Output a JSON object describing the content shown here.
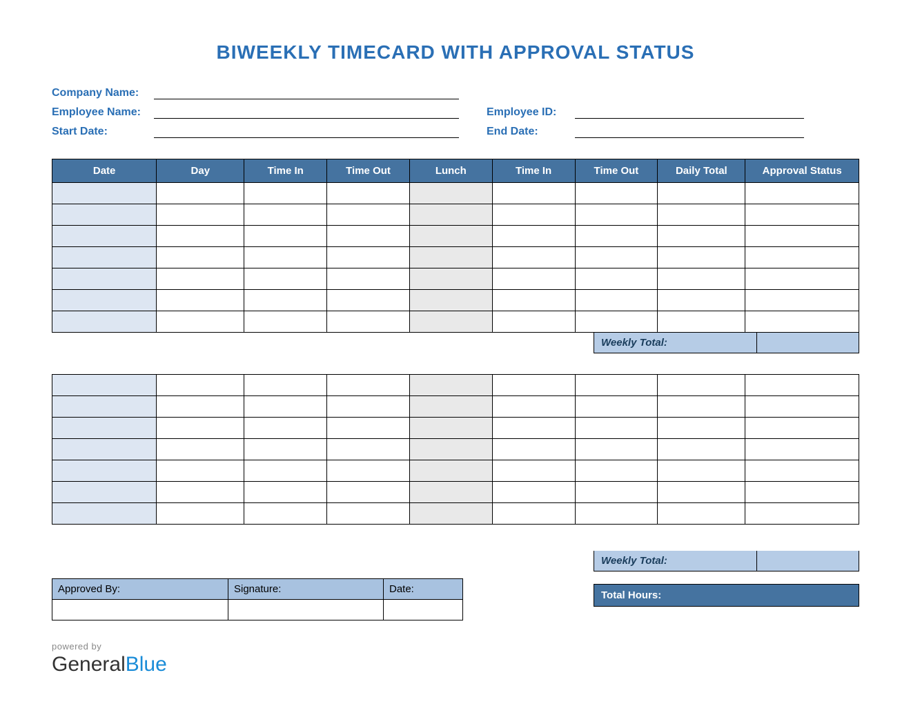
{
  "title": "BIWEEKLY TIMECARD WITH APPROVAL STATUS",
  "info": {
    "company_name_label": "Company Name:",
    "employee_name_label": "Employee Name:",
    "employee_id_label": "Employee ID:",
    "start_date_label": "Start Date:",
    "end_date_label": "End Date:",
    "company_name": "",
    "employee_name": "",
    "employee_id": "",
    "start_date": "",
    "end_date": ""
  },
  "headers": {
    "date": "Date",
    "day": "Day",
    "time_in_1": "Time In",
    "time_out_1": "Time Out",
    "lunch": "Lunch",
    "time_in_2": "Time In",
    "time_out_2": "Time Out",
    "daily_total": "Daily Total",
    "approval_status": "Approval Status"
  },
  "weekly_total_label": "Weekly Total:",
  "weekly_total_1": "",
  "weekly_total_2": "",
  "approval": {
    "approved_by_label": "Approved By:",
    "signature_label": "Signature:",
    "date_label": "Date:",
    "approved_by": "",
    "signature": "",
    "date": ""
  },
  "total_hours_label": "Total Hours:",
  "total_hours": "",
  "footer": {
    "powered_by": "powered by",
    "brand_a": "General",
    "brand_b": "Blue"
  }
}
